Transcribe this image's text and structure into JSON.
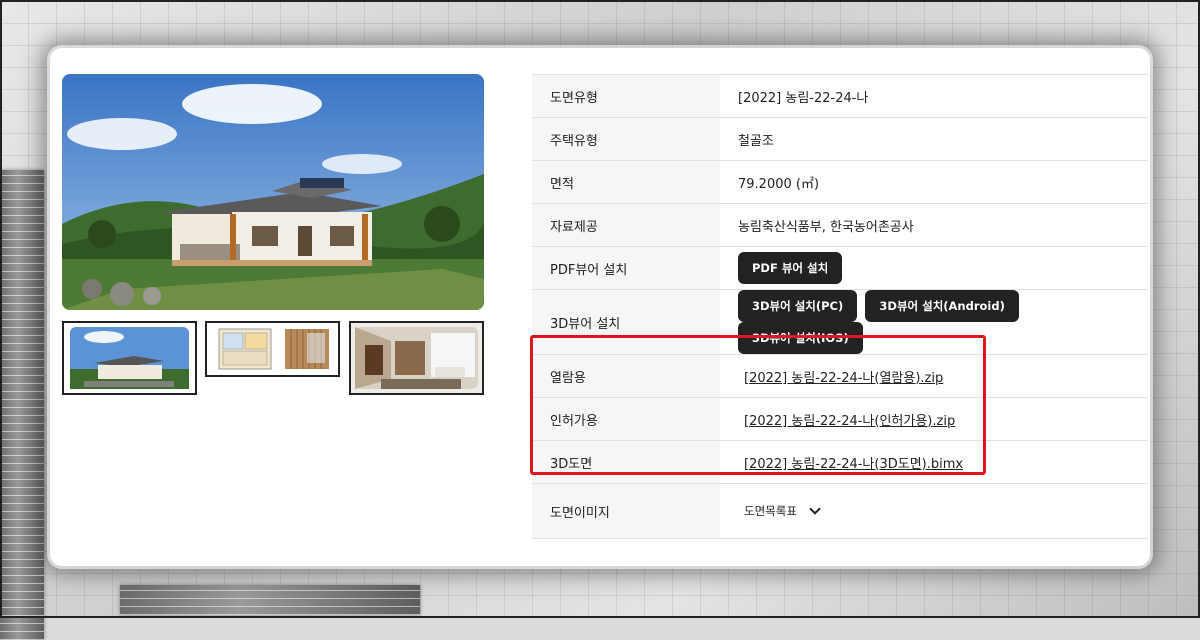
{
  "table": {
    "rows": [
      {
        "label": "도면유형",
        "value": "[2022] 농림-22-24-나"
      },
      {
        "label": "주택유형",
        "value": "철골조"
      },
      {
        "label": "면적",
        "value": "79.2000 (㎡)"
      },
      {
        "label": "자료제공",
        "value": "농림축산식품부, 한국농어촌공사"
      },
      {
        "label": "PDF뷰어 설치",
        "button": "PDF 뷰어 설치"
      },
      {
        "label": "3D뷰어 설치",
        "buttons": [
          "3D뷰어 설치(PC)",
          "3D뷰어 설치(Android)",
          "3D뷰어 설치(IOS)"
        ]
      },
      {
        "label": "열람용",
        "link": "[2022] 농림-22-24-나(열람용).zip"
      },
      {
        "label": "인허가용",
        "link": "[2022] 농림-22-24-나(인허가용).zip"
      },
      {
        "label": "3D도면",
        "link": "[2022] 농림-22-24-나(3D도면).bimx"
      },
      {
        "label": "도면이미지",
        "select": "도면목록표"
      }
    ]
  },
  "gallery": {
    "main_image": "house-render-exterior",
    "thumbnails": [
      "house-exterior",
      "floor-plan",
      "interior-living-room"
    ]
  },
  "colors": {
    "highlight": "#e0161e",
    "button_bg": "#222222",
    "label_bg": "#f6f6f6"
  }
}
